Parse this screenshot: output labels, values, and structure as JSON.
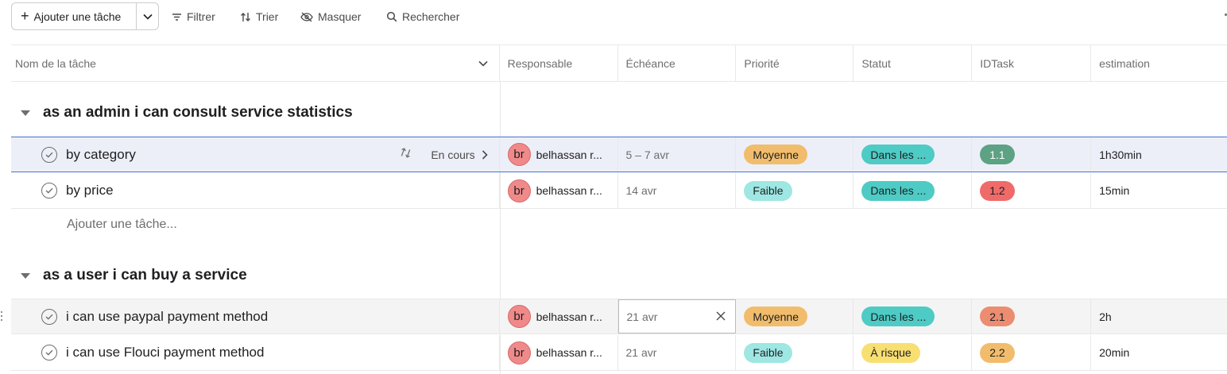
{
  "toolbar": {
    "add_task_label": "Ajouter une tâche",
    "filter_label": "Filtrer",
    "sort_label": "Trier",
    "hide_label": "Masquer",
    "search_label": "Rechercher"
  },
  "columns": {
    "name": "Nom de la tâche",
    "assignee": "Responsable",
    "due": "Échéance",
    "priority": "Priorité",
    "status": "Statut",
    "idtask": "IDTask",
    "estimation": "estimation"
  },
  "sections": [
    {
      "title": "as an admin i can consult service statistics",
      "tasks": [
        {
          "name": "by category",
          "subtask_status": "En cours",
          "assignee_initials": "br",
          "assignee": "belhassan r...",
          "due": "5 – 7 avr",
          "priority": "Moyenne",
          "status": "Dans les ...",
          "idtask": "1.1",
          "estimation": "1h30min"
        },
        {
          "name": "by price",
          "assignee_initials": "br",
          "assignee": "belhassan r...",
          "due": "14 avr",
          "priority": "Faible",
          "status": "Dans les ...",
          "idtask": "1.2",
          "estimation": "15min"
        }
      ],
      "add_task_placeholder": "Ajouter une tâche..."
    },
    {
      "title": "as a user i can buy a service",
      "tasks": [
        {
          "name": "i can use paypal payment method",
          "assignee_initials": "br",
          "assignee": "belhassan r...",
          "due": "21 avr",
          "priority": "Moyenne",
          "status": "Dans les ...",
          "idtask": "2.1",
          "estimation": "2h"
        },
        {
          "name": "i can use Flouci payment method",
          "assignee_initials": "br",
          "assignee": "belhassan r...",
          "due": "21 avr",
          "priority": "Faible",
          "status": "À risque",
          "idtask": "2.2",
          "estimation": "20min"
        }
      ]
    }
  ],
  "colors": {
    "priority_moyenne": "#f1bd6c",
    "priority_faible": "#9ee7e3",
    "status_dans_les": "#4ecbc4",
    "status_a_risque": "#f8df72",
    "id_1_1": "#5da283",
    "id_1_2": "#f06a6a",
    "id_2_1": "#ec8d71",
    "id_2_2": "#f1bd6c",
    "avatar": "#f08a8a",
    "selection_border": "#4573d2"
  }
}
